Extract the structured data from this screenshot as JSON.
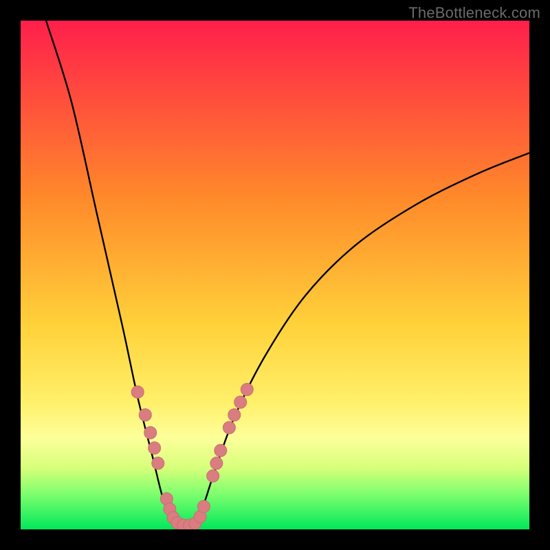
{
  "watermark": "TheBottleneck.com",
  "colors": {
    "frame_border": "#000000",
    "curve_stroke": "#000000",
    "marker_fill": "#d97d81",
    "marker_stroke": "#c86d72"
  },
  "chart_data": {
    "type": "line",
    "title": "",
    "xlabel": "",
    "ylabel": "",
    "xlim": [
      0,
      100
    ],
    "ylim": [
      0,
      100
    ],
    "grid": false,
    "legend": false,
    "note": "V-shaped bottleneck curve over a red→yellow→green vertical gradient. Values are approximate, read from pixel positions; y=0 is the bottom (green), y=100 is the top (red).",
    "gradient_stops": [
      {
        "pct": 0,
        "color": "#ff1f4b"
      },
      {
        "pct": 35,
        "color": "#ff8a2a"
      },
      {
        "pct": 60,
        "color": "#ffd23a"
      },
      {
        "pct": 75,
        "color": "#fff06a"
      },
      {
        "pct": 82,
        "color": "#fdff9a"
      },
      {
        "pct": 88,
        "color": "#d6ff7a"
      },
      {
        "pct": 93,
        "color": "#7eff6e"
      },
      {
        "pct": 100,
        "color": "#00e85a"
      }
    ],
    "series": [
      {
        "name": "left-branch",
        "points": [
          {
            "x": 5,
            "y": 100
          },
          {
            "x": 10,
            "y": 84
          },
          {
            "x": 15,
            "y": 62
          },
          {
            "x": 20,
            "y": 40
          },
          {
            "x": 23,
            "y": 26
          },
          {
            "x": 26,
            "y": 14
          },
          {
            "x": 28,
            "y": 6
          },
          {
            "x": 30,
            "y": 1
          }
        ]
      },
      {
        "name": "right-branch",
        "points": [
          {
            "x": 34,
            "y": 1
          },
          {
            "x": 36,
            "y": 5
          },
          {
            "x": 38,
            "y": 11
          },
          {
            "x": 42,
            "y": 22
          },
          {
            "x": 48,
            "y": 34
          },
          {
            "x": 56,
            "y": 46
          },
          {
            "x": 66,
            "y": 56
          },
          {
            "x": 78,
            "y": 64
          },
          {
            "x": 90,
            "y": 70
          },
          {
            "x": 100,
            "y": 74
          }
        ]
      }
    ],
    "markers": [
      {
        "x": 23.0,
        "y": 27.0
      },
      {
        "x": 24.5,
        "y": 22.5
      },
      {
        "x": 25.5,
        "y": 19.0
      },
      {
        "x": 26.3,
        "y": 16.0
      },
      {
        "x": 27.0,
        "y": 13.0
      },
      {
        "x": 28.7,
        "y": 6.0
      },
      {
        "x": 29.3,
        "y": 4.0
      },
      {
        "x": 30.0,
        "y": 2.3
      },
      {
        "x": 30.8,
        "y": 1.3
      },
      {
        "x": 32.0,
        "y": 0.8
      },
      {
        "x": 33.2,
        "y": 0.8
      },
      {
        "x": 34.3,
        "y": 1.2
      },
      {
        "x": 35.3,
        "y": 2.5
      },
      {
        "x": 36.0,
        "y": 4.5
      },
      {
        "x": 37.8,
        "y": 10.5
      },
      {
        "x": 38.5,
        "y": 13.0
      },
      {
        "x": 39.3,
        "y": 15.5
      },
      {
        "x": 41.0,
        "y": 20.0
      },
      {
        "x": 42.0,
        "y": 22.5
      },
      {
        "x": 43.2,
        "y": 25.0
      },
      {
        "x": 44.5,
        "y": 27.5
      }
    ],
    "marker_radius_px": 9
  }
}
